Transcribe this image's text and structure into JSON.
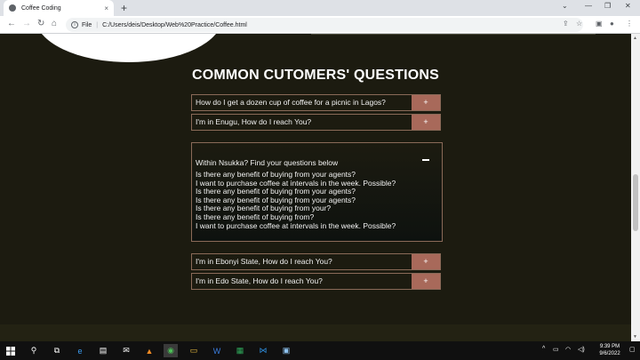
{
  "browser": {
    "tab_title": "Coffee Coding",
    "tab_close": "×",
    "new_tab": "+",
    "address_label": "File",
    "address_url": "C:/Users/deis/Desktop/Web%20Practice/Coffee.html"
  },
  "faq": {
    "title": "COMMON CUTOMERS' QUESTIONS",
    "items": [
      {
        "question": "How do I get a dozen cup of coffee for a picnic in Lagos?",
        "toggle": "+"
      },
      {
        "question": "I'm in Enugu, How do I reach You?",
        "toggle": "+"
      }
    ],
    "expanded": {
      "question": "Within Nsukka? Find your questions below",
      "toggle": "−",
      "answers": [
        "Is there any benefit of buying from your agents?",
        "I want to purchase coffee at intervals in the week. Possible?",
        "Is there any benefit of buying from your agents?",
        "Is there any benefit of buying from your agents?",
        "Is there any benefit of buying from your?",
        "Is there any benefit of buying from?",
        "I want to purchase coffee at intervals in the week. Possible?"
      ]
    },
    "items_after": [
      {
        "question": "I'm in Ebonyi State, How do I reach You?",
        "toggle": "+"
      },
      {
        "question": "I'm in Edo State, How do I reach You?",
        "toggle": "+"
      }
    ]
  },
  "taskbar": {
    "time": "9:39 PM",
    "date": "9/6/2022"
  },
  "colors": {
    "page_background": "#1c1b10",
    "accent_button": "#a8695a",
    "border": "#8a6a58"
  }
}
